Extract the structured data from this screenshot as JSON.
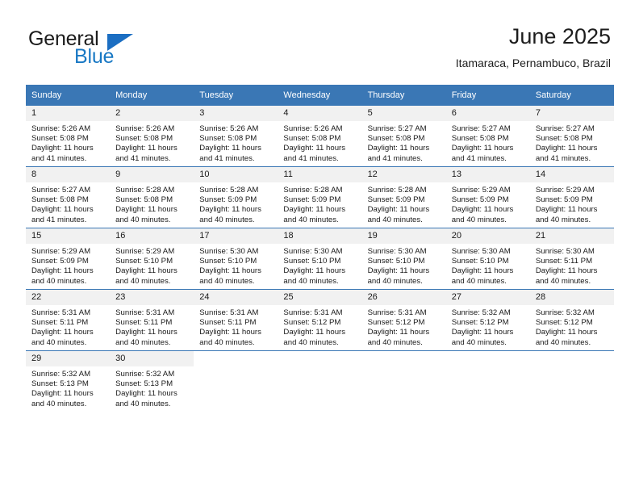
{
  "logo": {
    "text_primary": "General",
    "text_secondary": "Blue",
    "triangle_color": "#1b6ec2",
    "secondary_color": "#1878c4"
  },
  "header": {
    "title": "June 2025",
    "subtitle": "Itamaraca, Pernambuco, Brazil"
  },
  "theme": {
    "header_bg": "#3a77b5",
    "daynum_bg": "#f1f1f1",
    "text": "#1a1a1a"
  },
  "weekday_headers": [
    "Sunday",
    "Monday",
    "Tuesday",
    "Wednesday",
    "Thursday",
    "Friday",
    "Saturday"
  ],
  "weeks": [
    {
      "days": [
        {
          "day": "1",
          "sunrise": "Sunrise: 5:26 AM",
          "sunset": "Sunset: 5:08 PM",
          "daylight_line1": "Daylight: 11 hours",
          "daylight_line2": "and 41 minutes."
        },
        {
          "day": "2",
          "sunrise": "Sunrise: 5:26 AM",
          "sunset": "Sunset: 5:08 PM",
          "daylight_line1": "Daylight: 11 hours",
          "daylight_line2": "and 41 minutes."
        },
        {
          "day": "3",
          "sunrise": "Sunrise: 5:26 AM",
          "sunset": "Sunset: 5:08 PM",
          "daylight_line1": "Daylight: 11 hours",
          "daylight_line2": "and 41 minutes."
        },
        {
          "day": "4",
          "sunrise": "Sunrise: 5:26 AM",
          "sunset": "Sunset: 5:08 PM",
          "daylight_line1": "Daylight: 11 hours",
          "daylight_line2": "and 41 minutes."
        },
        {
          "day": "5",
          "sunrise": "Sunrise: 5:27 AM",
          "sunset": "Sunset: 5:08 PM",
          "daylight_line1": "Daylight: 11 hours",
          "daylight_line2": "and 41 minutes."
        },
        {
          "day": "6",
          "sunrise": "Sunrise: 5:27 AM",
          "sunset": "Sunset: 5:08 PM",
          "daylight_line1": "Daylight: 11 hours",
          "daylight_line2": "and 41 minutes."
        },
        {
          "day": "7",
          "sunrise": "Sunrise: 5:27 AM",
          "sunset": "Sunset: 5:08 PM",
          "daylight_line1": "Daylight: 11 hours",
          "daylight_line2": "and 41 minutes."
        }
      ]
    },
    {
      "days": [
        {
          "day": "8",
          "sunrise": "Sunrise: 5:27 AM",
          "sunset": "Sunset: 5:08 PM",
          "daylight_line1": "Daylight: 11 hours",
          "daylight_line2": "and 41 minutes."
        },
        {
          "day": "9",
          "sunrise": "Sunrise: 5:28 AM",
          "sunset": "Sunset: 5:08 PM",
          "daylight_line1": "Daylight: 11 hours",
          "daylight_line2": "and 40 minutes."
        },
        {
          "day": "10",
          "sunrise": "Sunrise: 5:28 AM",
          "sunset": "Sunset: 5:09 PM",
          "daylight_line1": "Daylight: 11 hours",
          "daylight_line2": "and 40 minutes."
        },
        {
          "day": "11",
          "sunrise": "Sunrise: 5:28 AM",
          "sunset": "Sunset: 5:09 PM",
          "daylight_line1": "Daylight: 11 hours",
          "daylight_line2": "and 40 minutes."
        },
        {
          "day": "12",
          "sunrise": "Sunrise: 5:28 AM",
          "sunset": "Sunset: 5:09 PM",
          "daylight_line1": "Daylight: 11 hours",
          "daylight_line2": "and 40 minutes."
        },
        {
          "day": "13",
          "sunrise": "Sunrise: 5:29 AM",
          "sunset": "Sunset: 5:09 PM",
          "daylight_line1": "Daylight: 11 hours",
          "daylight_line2": "and 40 minutes."
        },
        {
          "day": "14",
          "sunrise": "Sunrise: 5:29 AM",
          "sunset": "Sunset: 5:09 PM",
          "daylight_line1": "Daylight: 11 hours",
          "daylight_line2": "and 40 minutes."
        }
      ]
    },
    {
      "days": [
        {
          "day": "15",
          "sunrise": "Sunrise: 5:29 AM",
          "sunset": "Sunset: 5:09 PM",
          "daylight_line1": "Daylight: 11 hours",
          "daylight_line2": "and 40 minutes."
        },
        {
          "day": "16",
          "sunrise": "Sunrise: 5:29 AM",
          "sunset": "Sunset: 5:10 PM",
          "daylight_line1": "Daylight: 11 hours",
          "daylight_line2": "and 40 minutes."
        },
        {
          "day": "17",
          "sunrise": "Sunrise: 5:30 AM",
          "sunset": "Sunset: 5:10 PM",
          "daylight_line1": "Daylight: 11 hours",
          "daylight_line2": "and 40 minutes."
        },
        {
          "day": "18",
          "sunrise": "Sunrise: 5:30 AM",
          "sunset": "Sunset: 5:10 PM",
          "daylight_line1": "Daylight: 11 hours",
          "daylight_line2": "and 40 minutes."
        },
        {
          "day": "19",
          "sunrise": "Sunrise: 5:30 AM",
          "sunset": "Sunset: 5:10 PM",
          "daylight_line1": "Daylight: 11 hours",
          "daylight_line2": "and 40 minutes."
        },
        {
          "day": "20",
          "sunrise": "Sunrise: 5:30 AM",
          "sunset": "Sunset: 5:10 PM",
          "daylight_line1": "Daylight: 11 hours",
          "daylight_line2": "and 40 minutes."
        },
        {
          "day": "21",
          "sunrise": "Sunrise: 5:30 AM",
          "sunset": "Sunset: 5:11 PM",
          "daylight_line1": "Daylight: 11 hours",
          "daylight_line2": "and 40 minutes."
        }
      ]
    },
    {
      "days": [
        {
          "day": "22",
          "sunrise": "Sunrise: 5:31 AM",
          "sunset": "Sunset: 5:11 PM",
          "daylight_line1": "Daylight: 11 hours",
          "daylight_line2": "and 40 minutes."
        },
        {
          "day": "23",
          "sunrise": "Sunrise: 5:31 AM",
          "sunset": "Sunset: 5:11 PM",
          "daylight_line1": "Daylight: 11 hours",
          "daylight_line2": "and 40 minutes."
        },
        {
          "day": "24",
          "sunrise": "Sunrise: 5:31 AM",
          "sunset": "Sunset: 5:11 PM",
          "daylight_line1": "Daylight: 11 hours",
          "daylight_line2": "and 40 minutes."
        },
        {
          "day": "25",
          "sunrise": "Sunrise: 5:31 AM",
          "sunset": "Sunset: 5:12 PM",
          "daylight_line1": "Daylight: 11 hours",
          "daylight_line2": "and 40 minutes."
        },
        {
          "day": "26",
          "sunrise": "Sunrise: 5:31 AM",
          "sunset": "Sunset: 5:12 PM",
          "daylight_line1": "Daylight: 11 hours",
          "daylight_line2": "and 40 minutes."
        },
        {
          "day": "27",
          "sunrise": "Sunrise: 5:32 AM",
          "sunset": "Sunset: 5:12 PM",
          "daylight_line1": "Daylight: 11 hours",
          "daylight_line2": "and 40 minutes."
        },
        {
          "day": "28",
          "sunrise": "Sunrise: 5:32 AM",
          "sunset": "Sunset: 5:12 PM",
          "daylight_line1": "Daylight: 11 hours",
          "daylight_line2": "and 40 minutes."
        }
      ]
    },
    {
      "days": [
        {
          "day": "29",
          "sunrise": "Sunrise: 5:32 AM",
          "sunset": "Sunset: 5:13 PM",
          "daylight_line1": "Daylight: 11 hours",
          "daylight_line2": "and 40 minutes."
        },
        {
          "day": "30",
          "sunrise": "Sunrise: 5:32 AM",
          "sunset": "Sunset: 5:13 PM",
          "daylight_line1": "Daylight: 11 hours",
          "daylight_line2": "and 40 minutes."
        },
        {
          "day": "",
          "sunrise": "",
          "sunset": "",
          "daylight_line1": "",
          "daylight_line2": ""
        },
        {
          "day": "",
          "sunrise": "",
          "sunset": "",
          "daylight_line1": "",
          "daylight_line2": ""
        },
        {
          "day": "",
          "sunrise": "",
          "sunset": "",
          "daylight_line1": "",
          "daylight_line2": ""
        },
        {
          "day": "",
          "sunrise": "",
          "sunset": "",
          "daylight_line1": "",
          "daylight_line2": ""
        },
        {
          "day": "",
          "sunrise": "",
          "sunset": "",
          "daylight_line1": "",
          "daylight_line2": ""
        }
      ]
    }
  ]
}
